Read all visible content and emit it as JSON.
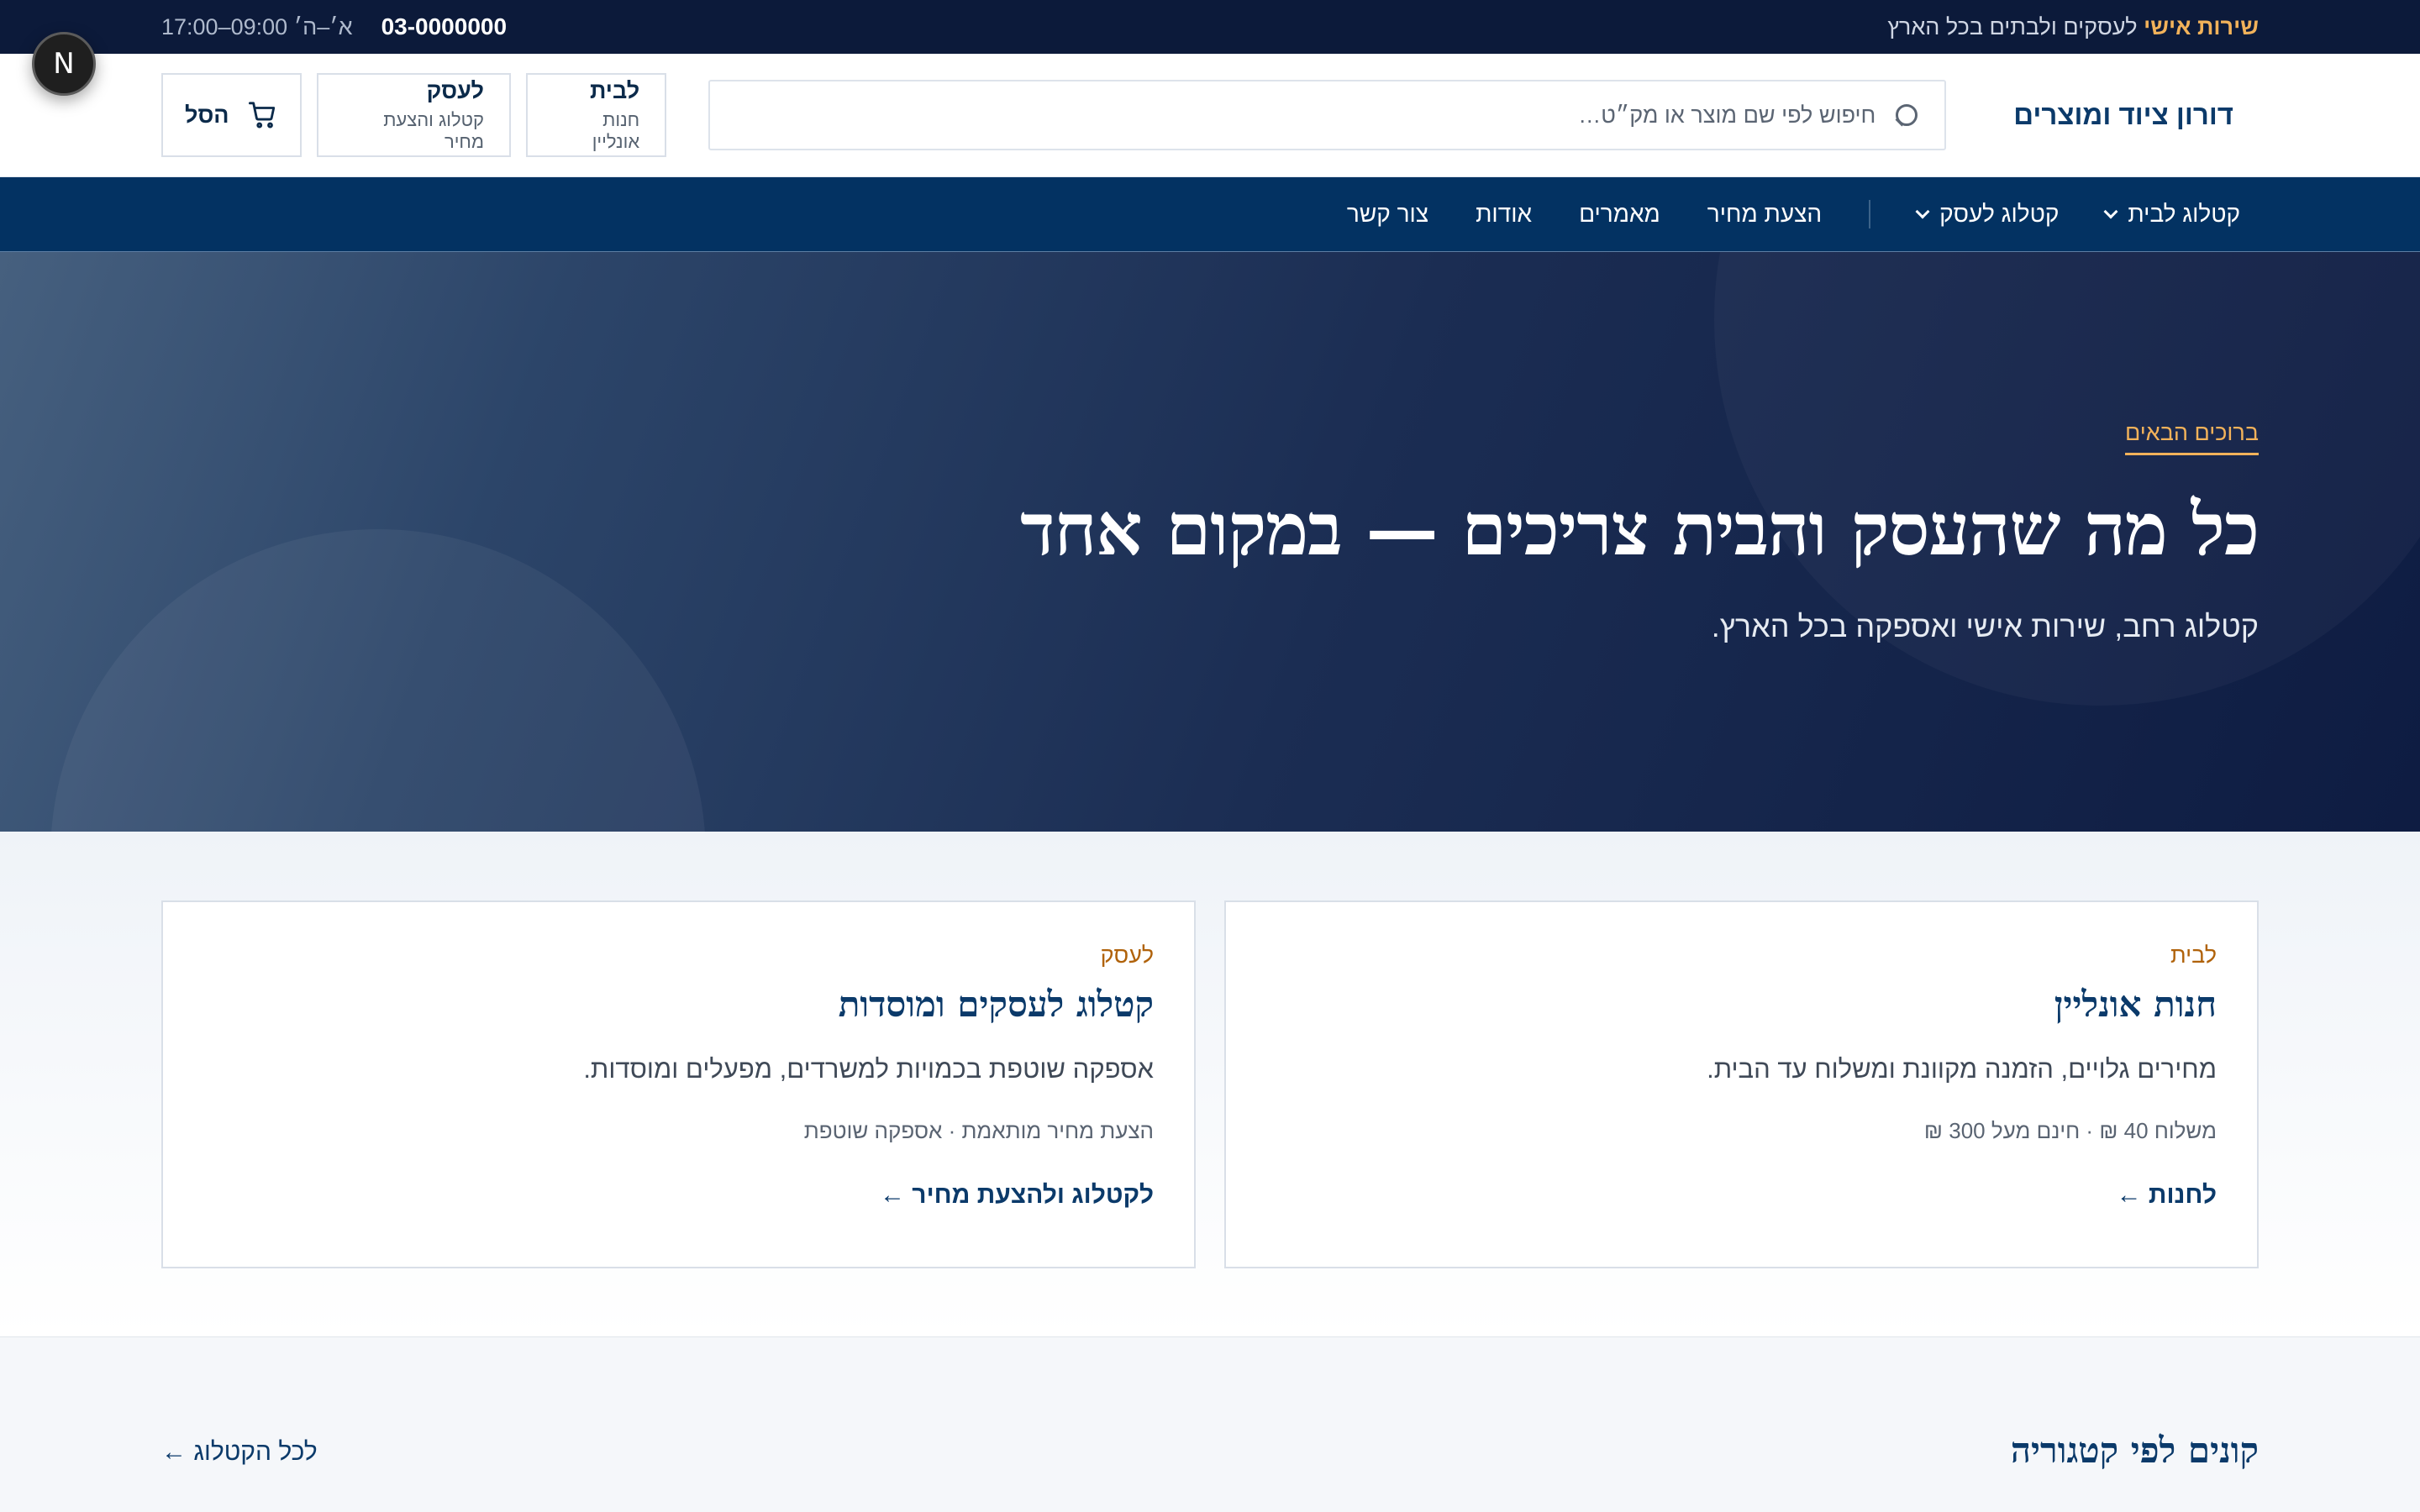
{
  "topbar": {
    "promo_accent": "שירות אישי",
    "promo_text": "לעסקים ולבתים בכל הארץ",
    "phone": "03-0000000",
    "hours": "א׳–ה׳ 09:00–17:00"
  },
  "header": {
    "brand": "דורון ציוד ומוצרים",
    "search_placeholder": "חיפוש לפי שם מוצר או מק״ט…",
    "home_btn": {
      "title": "לבית",
      "subtitle": "חנות אונליין"
    },
    "business_btn": {
      "title": "לעסק",
      "subtitle": "קטלוג והצעת מחיר"
    },
    "cart_label": "הסל"
  },
  "nav": {
    "items": [
      "קטלוג לבית",
      "קטלוג לעסק",
      "הצעת מחיר",
      "מאמרים",
      "אודות",
      "צור קשר"
    ]
  },
  "hero": {
    "eyebrow": "ברוכים הבאים",
    "title": "כל מה שהעסק והבית צריכים — במקום אחד",
    "subtitle": "קטלוג רחב, שירות אישי ואספקה בכל הארץ."
  },
  "cards": [
    {
      "tag": "לבית",
      "title": "חנות אונליין",
      "desc": "מחירים גלויים, הזמנה מקוונת ומשלוח עד הבית.",
      "meta": "משלוח 40 ₪ · חינם מעל 300 ₪",
      "cta": "לחנות ←"
    },
    {
      "tag": "לעסק",
      "title": "קטלוג לעסקים ומוסדות",
      "desc": "אספקה שוטפת בכמויות למשרדים, מפעלים ומוסדות.",
      "meta": "הצעת מחיר מותאמת · אספקה שוטפת",
      "cta": "לקטלוג ולהצעת מחיר ←"
    }
  ],
  "categories": {
    "heading": "קונים לפי קטגוריה",
    "all_link": "לכל הקטלוג ←"
  },
  "badge": {
    "letter": "N"
  },
  "colors": {
    "topbar_bg": "#0c1a3a",
    "nav_bg": "#033262",
    "accent": "#f2b25a",
    "brand_text": "#0b3a6a"
  }
}
